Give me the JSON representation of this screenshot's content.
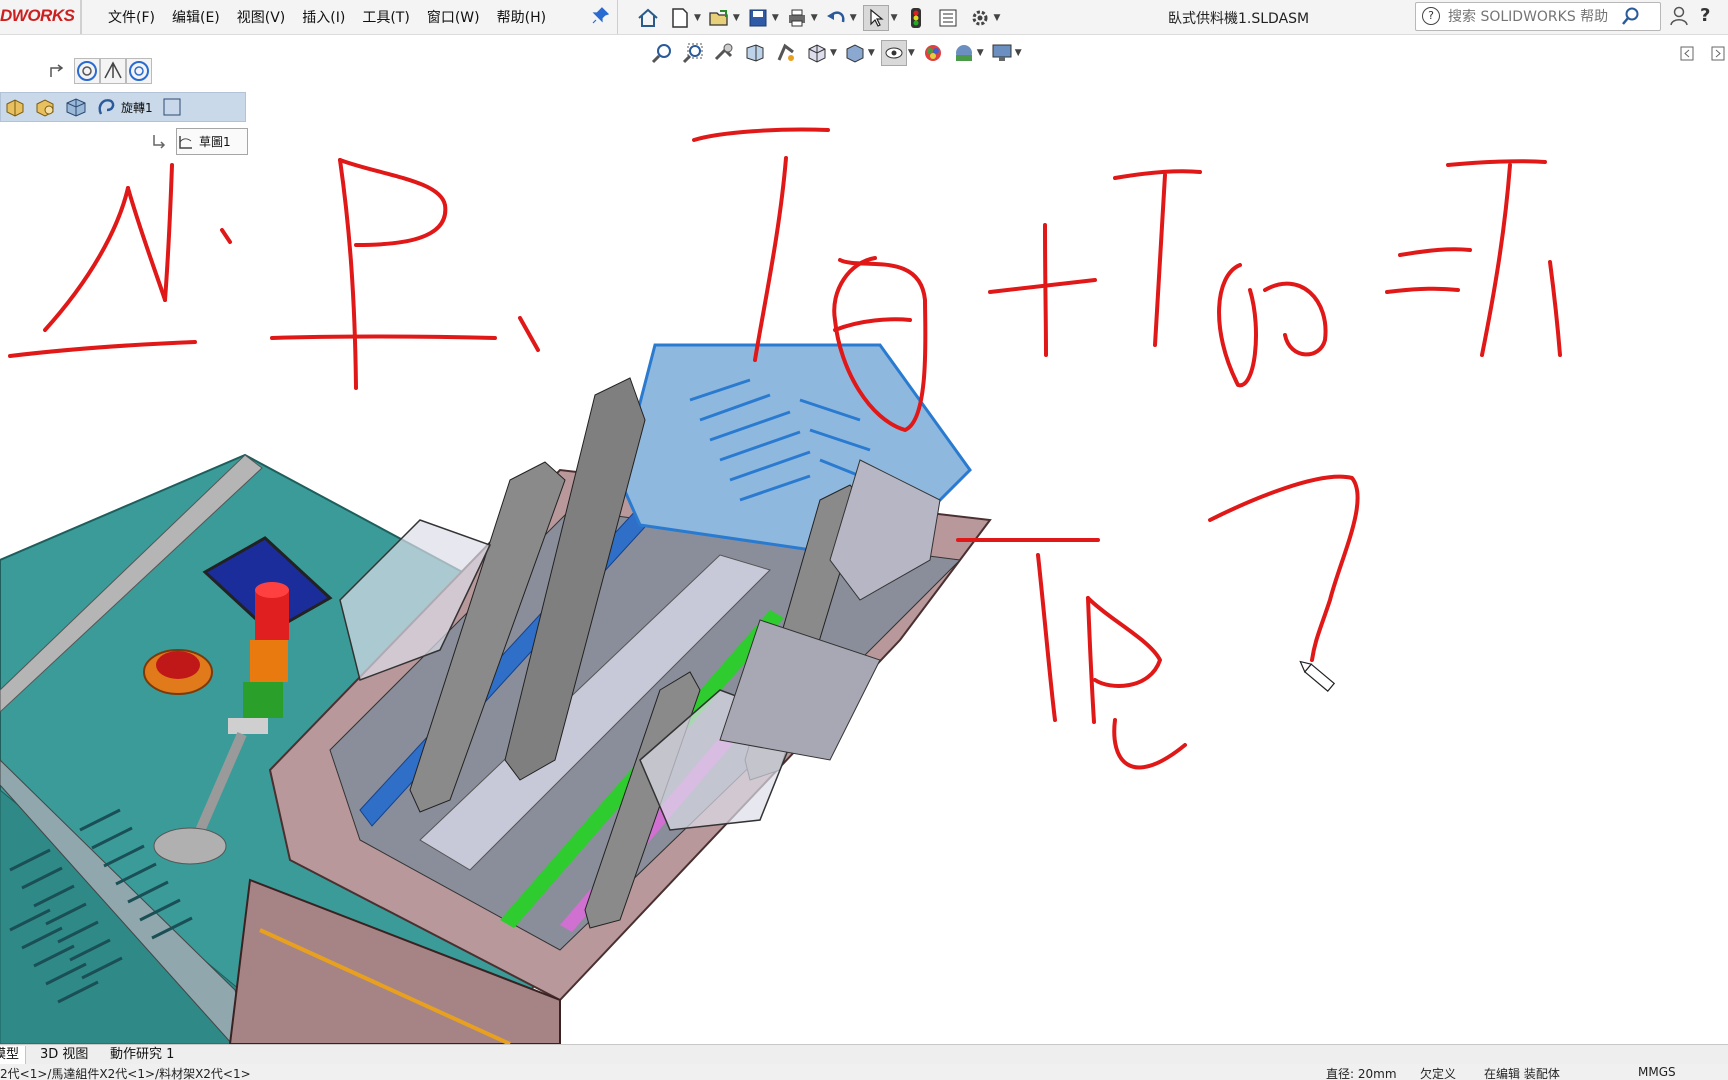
{
  "app": {
    "logo_text": "DWORKS",
    "title": "臥式供料機1.SLDASM"
  },
  "menu": {
    "items": [
      "文件(F)",
      "编辑(E)",
      "视图(V)",
      "插入(I)",
      "工具(T)",
      "窗口(W)",
      "帮助(H)"
    ]
  },
  "toolbar": {
    "icons": [
      "home-icon",
      "new-doc-icon",
      "open-icon",
      "save-icon",
      "print-icon",
      "undo-icon",
      "select-icon",
      "rebuild-icon",
      "file-properties-icon",
      "options-icon"
    ]
  },
  "search": {
    "placeholder": "搜索 SOLIDWORKS 帮助"
  },
  "view_toolbar": {
    "icons": [
      "zoom-to-fit-icon",
      "zoom-area-icon",
      "previous-view-icon",
      "section-view-icon",
      "dynamic-annotation-icon",
      "view-orientation-icon",
      "display-style-icon",
      "hide-show-icon",
      "edit-appearance-icon",
      "apply-scene-icon",
      "view-settings-icon"
    ]
  },
  "breadcrumb": {
    "items": [
      {
        "icon": "assembly-icon",
        "label": ""
      },
      {
        "icon": "subassembly-icon",
        "label": ""
      },
      {
        "icon": "part-icon",
        "label": ""
      },
      {
        "icon": "revolve-icon",
        "label": "旋轉1"
      },
      {
        "icon": "plane-icon",
        "label": ""
      }
    ],
    "sketch_label": "草圖1"
  },
  "annotation": {
    "color": "#e01818"
  },
  "tabs": {
    "items": [
      "模型",
      "3D 视图",
      "動作研究 1"
    ],
    "active_index": 0
  },
  "status": {
    "path": "2代<1>/馬達組件X2代<1>/料材架X2代<1>",
    "diameter": "直径: 20mm",
    "undefined": "欠定义",
    "editing": "在编辑 装配体",
    "units": "MMGS"
  }
}
